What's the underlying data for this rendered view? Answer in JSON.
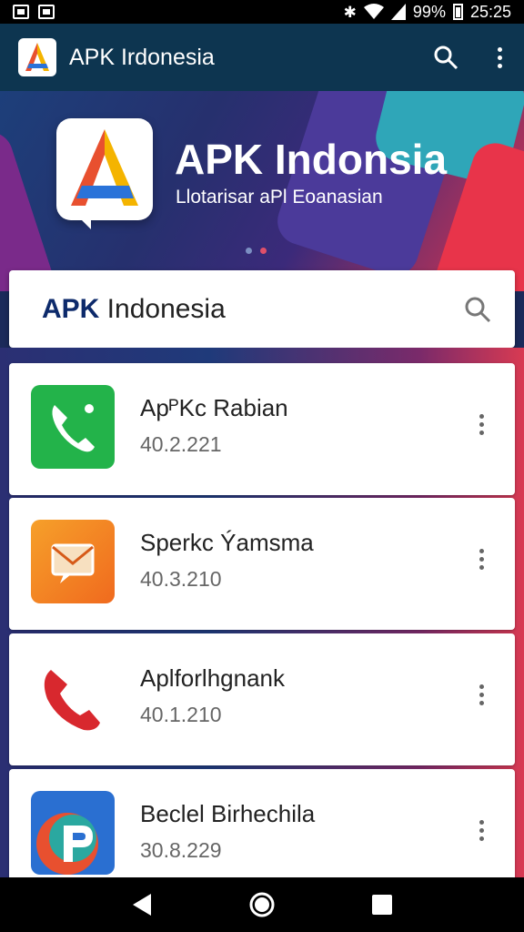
{
  "status_bar": {
    "battery": "99%",
    "time": "25:25"
  },
  "app_bar": {
    "title": "APK Irdonesia"
  },
  "hero": {
    "title": "APK Indonsia",
    "subtitle": "Llotarisar aPl Eoanasian",
    "dots": [
      "#7b8fc2",
      "#e0506a"
    ]
  },
  "search": {
    "brand": "APK",
    "rest": " Indonesia"
  },
  "apps": [
    {
      "name": "ApᴾKc Rabian",
      "version": "40.2.221",
      "icon": "phone-green-icon"
    },
    {
      "name": "Sperkc Ýamsma",
      "version": "40.3.210",
      "icon": "mail-orange-icon"
    },
    {
      "name": "Aplforlhgnank",
      "version": "40.1.210",
      "icon": "phone-red-icon"
    },
    {
      "name": "Beclel Birhechila",
      "version": "30.8.229",
      "icon": "p-badge-icon"
    }
  ],
  "colors": {
    "app_bar": "#0d3550",
    "accent_red": "#d8344b",
    "brand_blue": "#0d2a6b"
  }
}
